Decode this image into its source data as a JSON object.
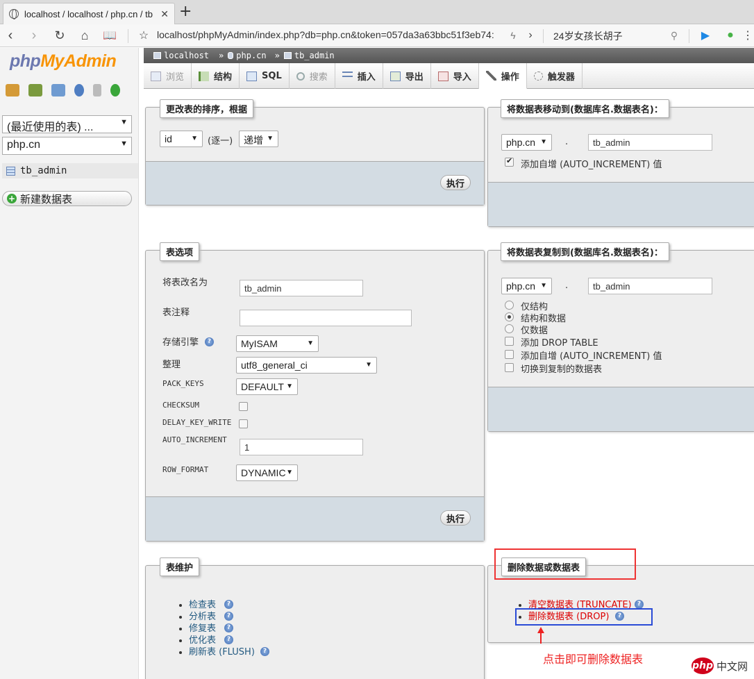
{
  "browser": {
    "tab_title": "localhost / localhost / php.cn / tb",
    "url": "localhost/phpMyAdmin/index.php?db=php.cn&token=057da3a63bbc51f3eb74:",
    "search_text": "24岁女孩长胡子"
  },
  "sidebar": {
    "logo_php": "php",
    "logo_myadmin": "MyAdmin",
    "recent_tables": "(最近使用的表) ...",
    "database": "php.cn",
    "table_item": "tb_admin",
    "new_table": "新建数据表"
  },
  "breadcrumb": {
    "server": "localhost",
    "database": "php.cn",
    "table": "tb_admin"
  },
  "tabs": [
    {
      "label": "浏览"
    },
    {
      "label": "结构"
    },
    {
      "label": "SQL"
    },
    {
      "label": "搜索"
    },
    {
      "label": "插入"
    },
    {
      "label": "导出"
    },
    {
      "label": "导入"
    },
    {
      "label": "操作"
    },
    {
      "label": "触发器"
    }
  ],
  "alter_order": {
    "legend": "更改表的排序，根据",
    "column": "id",
    "singly": "(逐一)",
    "order": "递增",
    "go": "执行"
  },
  "move_table": {
    "legend": "将数据表移动到(数据库名.数据表名)：",
    "db": "php.cn",
    "dot": ".",
    "table": "tb_admin",
    "auto_increment": "添加自增 (AUTO_INCREMENT) 值",
    "auto_increment_checked": true
  },
  "table_options": {
    "legend": "表选项",
    "rename_label": "将表改名为",
    "rename_value": "tb_admin",
    "comment_label": "表注释",
    "comment_value": "",
    "engine_label": "存储引擎",
    "engine_value": "MyISAM",
    "collation_label": "整理",
    "collation_value": "utf8_general_ci",
    "pack_keys_label": "PACK_KEYS",
    "pack_keys_value": "DEFAULT",
    "checksum_label": "CHECKSUM",
    "delay_key_write_label": "DELAY_KEY_WRITE",
    "auto_increment_label": "AUTO_INCREMENT",
    "auto_increment_value": "1",
    "row_format_label": "ROW_FORMAT",
    "row_format_value": "DYNAMIC",
    "go": "执行"
  },
  "copy_table": {
    "legend": "将数据表复制到(数据库名.数据表名)：",
    "db": "php.cn",
    "dot": ".",
    "table": "tb_admin",
    "options": [
      {
        "label": "仅结构",
        "checked": false
      },
      {
        "label": "结构和数据",
        "checked": true
      },
      {
        "label": "仅数据",
        "checked": false
      }
    ],
    "checks": [
      {
        "label": "添加 DROP TABLE"
      },
      {
        "label": "添加自增 (AUTO_INCREMENT) 值"
      },
      {
        "label": "切换到复制的数据表"
      }
    ]
  },
  "maintenance": {
    "legend": "表维护",
    "items": [
      {
        "label": "检查表"
      },
      {
        "label": "分析表"
      },
      {
        "label": "修复表"
      },
      {
        "label": "优化表"
      },
      {
        "label": "刷新表 (FLUSH)"
      }
    ]
  },
  "delete": {
    "legend": "删除数据或数据表",
    "truncate": "清空数据表 (TRUNCATE)",
    "drop": "删除数据表 (DROP)"
  },
  "annotation": {
    "hint": "点击即可删除数据表"
  },
  "watermark": {
    "logo": "php",
    "text": "中文网"
  }
}
